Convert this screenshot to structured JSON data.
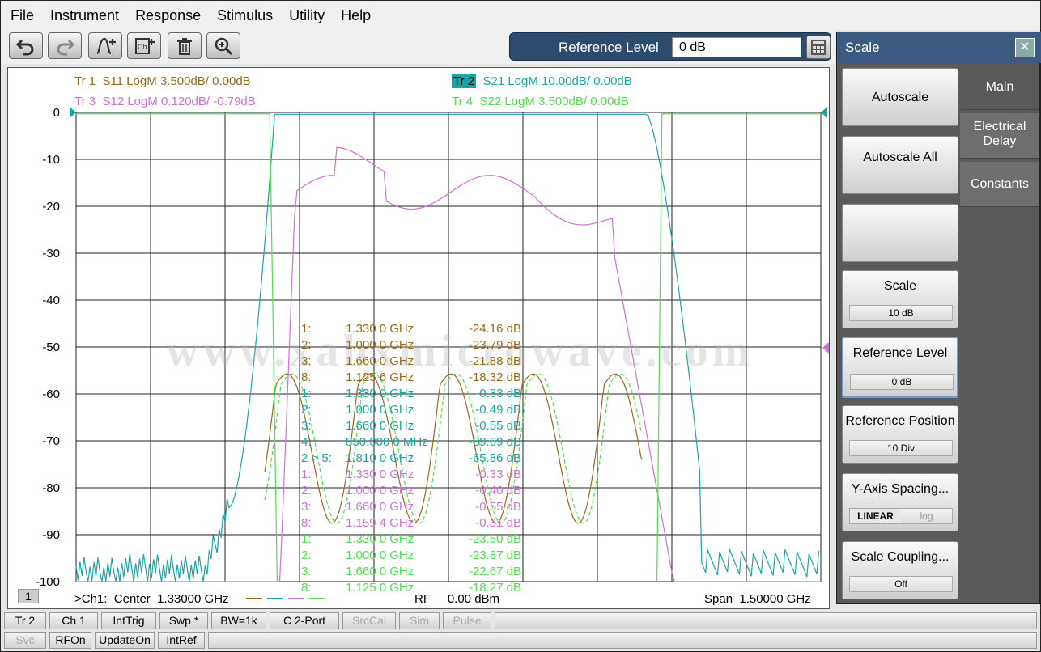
{
  "menu": [
    "File",
    "Instrument",
    "Response",
    "Stimulus",
    "Utility",
    "Help"
  ],
  "toolbar": {
    "buttons": [
      "undo-icon",
      "redo-icon",
      "add-trace-icon",
      "add-channel-icon",
      "delete-icon",
      "zoom-icon"
    ],
    "ref_label": "Reference Level",
    "ref_value": "0 dB"
  },
  "traces": [
    {
      "label": "Tr  1",
      "desc": "S11 LogM 3.500dB/  0.00dB",
      "color": "#9a6a1a"
    },
    {
      "label": "Tr  2",
      "desc": "S21 LogM 10.00dB/  0.00dB",
      "color": "#1aa5a5"
    },
    {
      "label": "Tr  3",
      "desc": "S12 LogM 0.120dB/  -0.79dB",
      "color": "#d070d8"
    },
    {
      "label": "Tr  4",
      "desc": "S22 LogM 3.500dB/  0.00dB",
      "color": "#50dd50"
    }
  ],
  "chart": {
    "y_ticks": [
      "0",
      "-10",
      "-20",
      "-30",
      "-40",
      "-50",
      "-60",
      "-70",
      "-80",
      "-90",
      "-100"
    ],
    "watermark": "www.xahxmicrowave.com",
    "channel_num": "1",
    "footer_left": ">Ch1:  Center  1.33000 GHz",
    "footer_mid": "RF     0.00 dBm",
    "footer_right": "Span  1.50000 GHz"
  },
  "markers": [
    {
      "id": "1:",
      "freq": "1.330 0 GHz",
      "val": "-24.16 dB",
      "color": "#9a6a1a"
    },
    {
      "id": "2:",
      "freq": "1.000 0 GHz",
      "val": "-23.79 dB",
      "color": "#9a6a1a"
    },
    {
      "id": "3:",
      "freq": "1.660 0 GHz",
      "val": "-21.88 dB",
      "color": "#9a6a1a"
    },
    {
      "id": "8:",
      "freq": "1.125 6 GHz",
      "val": "-18.32 dB",
      "color": "#9a6a1a"
    },
    {
      "id": "1:",
      "freq": "1.330 0 GHz",
      "val": "-0.33 dB",
      "color": "#1aa5a5"
    },
    {
      "id": "2:",
      "freq": "1.000 0 GHz",
      "val": "-0.49 dB",
      "color": "#1aa5a5"
    },
    {
      "id": "3:",
      "freq": "1.660 0 GHz",
      "val": "-0.55 dB",
      "color": "#1aa5a5"
    },
    {
      "id": "4:",
      "freq": "850.000 0 MHz",
      "val": "-89.69 dB",
      "color": "#1aa5a5"
    },
    {
      "id": "2 > 5:",
      "freq": "1.810 0 GHz",
      "val": "-65.86 dB",
      "color": "#1aa5a5"
    },
    {
      "id": "1:",
      "freq": "1.330 0 GHz",
      "val": "-0.33 dB",
      "color": "#d070d8"
    },
    {
      "id": "2:",
      "freq": "1.000 0 GHz",
      "val": "-0.40 dB",
      "color": "#d070d8"
    },
    {
      "id": "3:",
      "freq": "1.660 0 GHz",
      "val": "-0.55 dB",
      "color": "#d070d8"
    },
    {
      "id": "8:",
      "freq": "1.159 4 GHz",
      "val": "-0.31 dB",
      "color": "#d070d8"
    },
    {
      "id": "1:",
      "freq": "1.330 0 GHz",
      "val": "-23.50 dB",
      "color": "#50dd50"
    },
    {
      "id": "2:",
      "freq": "1.000 0 GHz",
      "val": "-23.87 dB",
      "color": "#50dd50"
    },
    {
      "id": "3:",
      "freq": "1.660 0 GHz",
      "val": "-22.67 dB",
      "color": "#50dd50"
    },
    {
      "id": "8:",
      "freq": "1.125 0 GHz",
      "val": "-18.27 dB",
      "color": "#50dd50"
    }
  ],
  "panel": {
    "title": "Scale",
    "close": "✕",
    "tabs": [
      "Main",
      "Electrical Delay",
      "Constants"
    ],
    "softkeys": [
      {
        "label": "Autoscale",
        "value": ""
      },
      {
        "label": "Autoscale All",
        "value": ""
      },
      {
        "label": "",
        "value": ""
      },
      {
        "label": "Scale",
        "value": "10 dB"
      },
      {
        "label": "Reference Level",
        "value": "0 dB"
      },
      {
        "label": "Reference Position",
        "value": "10 Div"
      },
      {
        "label": "Y-Axis Spacing...",
        "value_a": "LINEAR",
        "value_b": "log"
      },
      {
        "label": "Scale Coupling...",
        "value": "Off"
      }
    ]
  },
  "status_row1": [
    "Tr 2",
    "Ch 1",
    "IntTrig",
    "Swp *",
    "BW=1k",
    "C  2-Port",
    "SrcCal",
    "Sim",
    "Pulse"
  ],
  "status_row2": [
    "Svc",
    "RFOn",
    "UpdateOn",
    "IntRef"
  ]
}
